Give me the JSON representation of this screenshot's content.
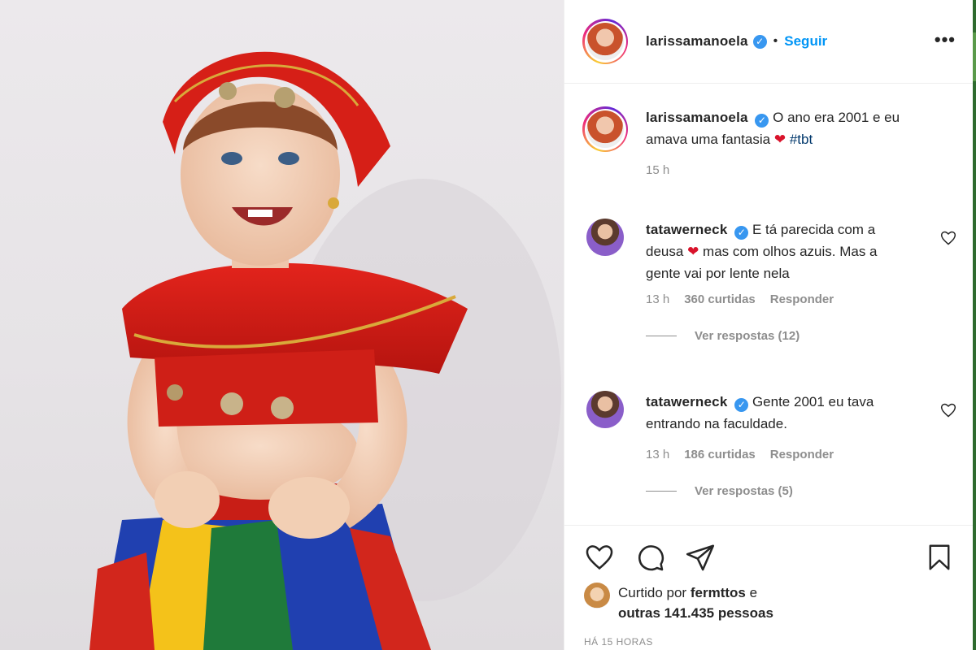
{
  "post": {
    "author": "larissamanoela",
    "follow_label": "Seguir",
    "more_label": "•••",
    "separator": "•"
  },
  "caption": {
    "username": "larissamanoela",
    "text_before": "O ano era 2001 e eu amava uma fantasia",
    "emoji": "❤",
    "hashtag": "#tbt",
    "time": "15 h"
  },
  "comments": [
    {
      "username": "tatawerneck",
      "text_before": "E tá parecida com a deusa",
      "emoji": "❤",
      "text_after": "mas com olhos azuis. Mas a gente vai por lente nela",
      "time": "13 h",
      "likes": "360 curtidas",
      "reply_label": "Responder",
      "view_replies": "Ver respostas (12)"
    },
    {
      "username": "tatawerneck",
      "text_before": "Gente 2001 eu tava entrando na faculdade.",
      "time": "13 h",
      "likes": "186 curtidas",
      "reply_label": "Responder",
      "view_replies": "Ver respostas (5)"
    }
  ],
  "likes_summary": {
    "prefix": "Curtido por",
    "user": "fermttos",
    "connector": "e",
    "others": "outras 141.435 pessoas"
  },
  "timestamp": "HÁ 15 HORAS",
  "icons": {
    "like": "heart-icon",
    "comment": "comment-icon",
    "share": "share-icon",
    "save": "bookmark-icon",
    "verified": "verified-badge-icon"
  },
  "colors": {
    "accent": "#0095f6",
    "verified": "#3897f0",
    "heart": "#d9132b",
    "hashtag": "#00376b",
    "muted": "#8e8e8e"
  }
}
